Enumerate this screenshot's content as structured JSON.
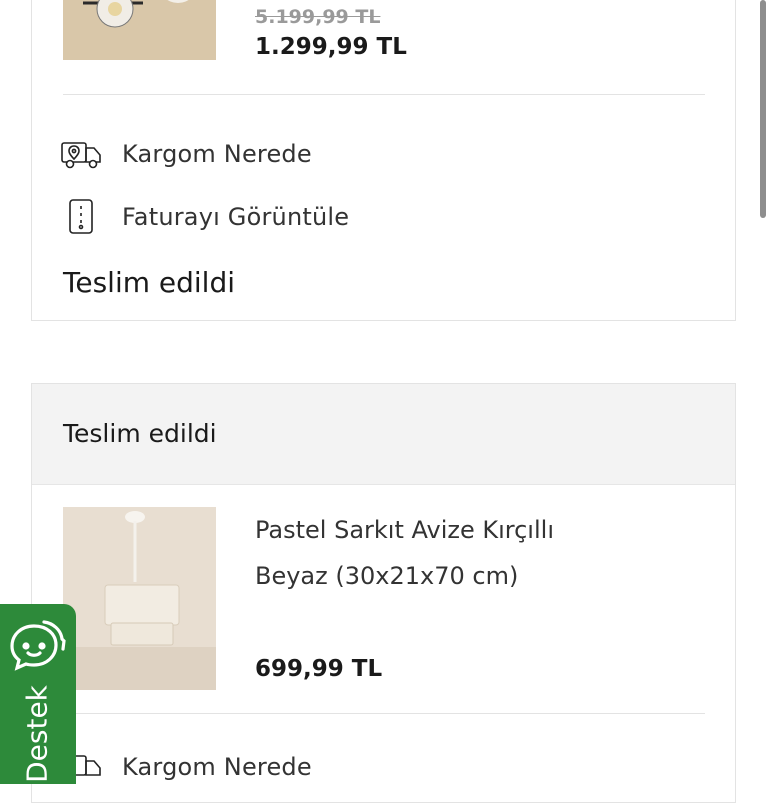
{
  "orders": [
    {
      "old_price": "5.199,99 TL",
      "price": "1.299,99 TL",
      "actions": {
        "track_label": "Kargom Nerede",
        "invoice_label": "Faturayı Görüntüle"
      },
      "status": "Teslim edildi",
      "icons": {
        "track": "truck-location-icon",
        "invoice": "invoice-document-icon"
      }
    },
    {
      "header_status": "Teslim edildi",
      "product": {
        "name_line1": "Pastel Sarkıt Avize Kırçıllı",
        "name_line2": "Beyaz (30x21x70 cm)"
      },
      "price": "699,99 TL",
      "actions": {
        "track_label": "Kargom Nerede"
      }
    }
  ],
  "support_tab": {
    "label": "Destek",
    "icon": "chat-support-icon",
    "color": "#2d8a3a"
  }
}
